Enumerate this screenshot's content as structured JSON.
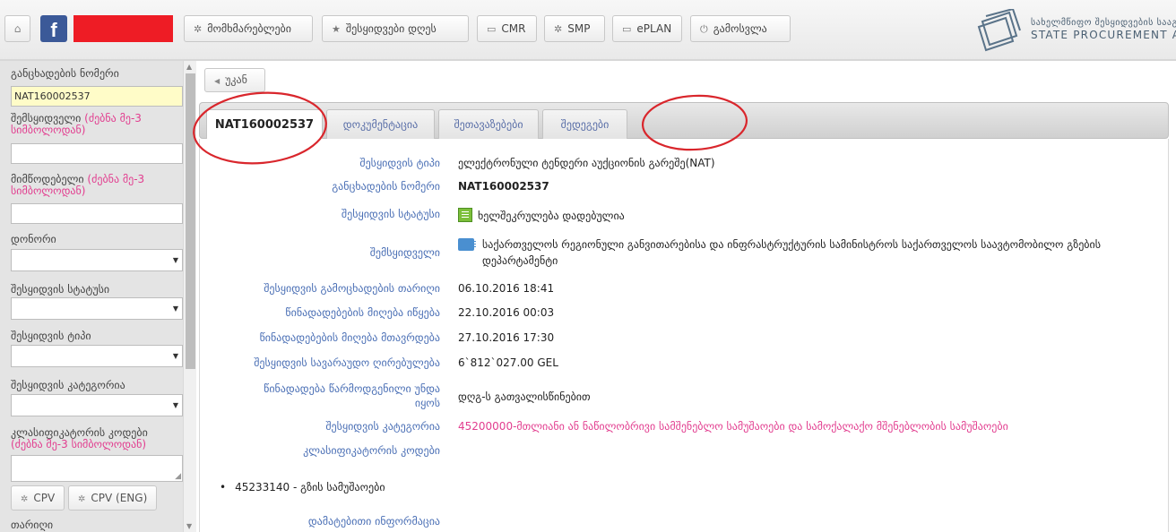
{
  "topbar": {
    "home_icon": "home-icon",
    "facebook_icon": "facebook-icon",
    "buttons": [
      {
        "label": "მომხმარებლები",
        "icon": "gear-icon"
      },
      {
        "label": "შესყიდვები დღეს",
        "icon": "star-icon"
      },
      {
        "label": "CMR",
        "icon": "window-icon"
      },
      {
        "label": "SMP",
        "icon": "gear-icon"
      },
      {
        "label": "ePLAN",
        "icon": "window-icon"
      },
      {
        "label": "გამოსვლა",
        "icon": "power-icon"
      }
    ],
    "logo": {
      "line1": "სახელმწიფო შესყიდვების სააგე",
      "line2": "STATE PROCUREMENT AGEN"
    }
  },
  "sidebar": {
    "fields": {
      "app_number_label": "განცხადების ნომერი",
      "app_number_value": "NAT160002537",
      "buyer_label": "შემსყიდველი",
      "buyer_hint": "(ძებნა მე-3 სიმბოლოდან)",
      "supplier_label": "მიმწოდებელი",
      "supplier_hint": "(ძებნა მე-3 სიმბოლოდან)",
      "donor_label": "დონორი",
      "status_label": "შესყიდვის სტატუსი",
      "type_label": "შესყიდვის ტიპი",
      "category_label": "შესყიდვის კატეგორია",
      "classifier_label": "კლასიფიკატორის კოდები",
      "classifier_hint": "(ძებნა მე-3 სიმბოლოდან)",
      "date_label": "თარიღი"
    },
    "buttons": {
      "cpv": "CPV",
      "cpv_eng": "CPV (ENG)"
    }
  },
  "main": {
    "back_label": "უკან",
    "tabs": [
      {
        "label": "NAT160002537",
        "active": true
      },
      {
        "label": "დოკუმენტაცია",
        "active": false
      },
      {
        "label": "შეთავაზებები",
        "active": false
      },
      {
        "label": "შედეგები",
        "active": false
      }
    ],
    "details": {
      "type_label": "შესყიდვის ტიპი",
      "type_value": "ელექტრონული ტენდერი აუქციონის გარეშე(NAT)",
      "number_label": "განცხადების ნომერი",
      "number_value": "NAT160002537",
      "status_label": "შესყიდვის სტატუსი",
      "status_value": "ხელშეკრულება დადებულია",
      "buyer_label": "შემსყიდველი",
      "buyer_value": "საქართველოს რეგიონული განვითარებისა და ინფრასტრუქტურის სამინისტროს საქართველოს საავტომობილო გზების დეპარტამენტი",
      "announce_label": "შესყიდვის გამოცხადების თარიღი",
      "announce_value": "06.10.2016 18:41",
      "bids_start_label": "წინადადებების მიღება იწყება",
      "bids_start_value": "22.10.2016 00:03",
      "bids_end_label": "წინადადებების მიღება მთავრდება",
      "bids_end_value": "27.10.2016 17:30",
      "estimated_label": "შესყიდვის სავარაუდო ღირებულება",
      "estimated_value": "6`812`027.00 GEL",
      "bid_vat_label_1": "წინადადება წარმოდგენილი უნდა",
      "bid_vat_label_2": "იყოს",
      "bid_vat_value": "დღგ-ს გათვალისწინებით",
      "category_label": "შესყიდვის კატეგორია",
      "category_value": "45200000-მთლიანი ან ნაწილობრივი სამშენებლო სამუშაოები და სამოქალაქო მშენებლობის სამუშაოები",
      "classifier_label": "კლასიფიკატორის კოდები",
      "cpv_item": "45233140 - გზის სამუშაოები",
      "extra_label": "დამატებითი ინფორმაცია"
    }
  },
  "colors": {
    "annotation": "#d9262c",
    "label_blue": "#4a6fb5",
    "accent_pink": "#e23d8f",
    "highlight_yellow": "#fffcc8"
  }
}
